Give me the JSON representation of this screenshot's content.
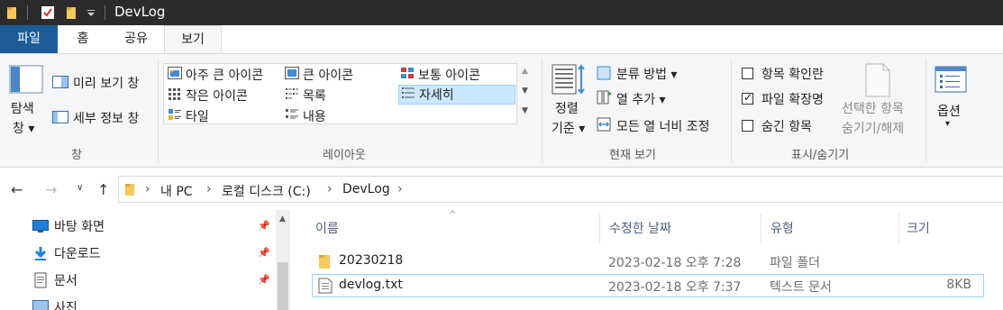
{
  "window": {
    "title": "DevLog"
  },
  "ribbon_tabs": [
    "파일",
    "홈",
    "공유",
    "보기"
  ],
  "ribbon": {
    "pane_group": {
      "navigation_pane_label_1": "탐색",
      "navigation_pane_label_2": "창 ▾",
      "preview_pane": "미리 보기 창",
      "details_pane": "세부 정보 창",
      "group_label": "창"
    },
    "layout_group": {
      "items": [
        "아주 큰 아이콘",
        "큰 아이콘",
        "보통 아이콘",
        "작은 아이콘",
        "목록",
        "자세히",
        "타일",
        "내용"
      ],
      "selected": "자세히",
      "group_label": "레이아웃"
    },
    "current_view_group": {
      "sort_by_1": "정렬",
      "sort_by_2": "기준 ▾",
      "group_by": "분류 방법 ▾",
      "add_columns": "열 추가 ▾",
      "size_all_columns": "모든 열 너비 조정",
      "group_label": "현재 보기"
    },
    "show_hide_group": {
      "item_check_boxes": "항목 확인란",
      "item_check_boxes_checked": false,
      "file_name_extensions": "파일 확장명",
      "file_name_extensions_checked": true,
      "hidden_items": "숨긴 항목",
      "hidden_items_checked": false,
      "hide_selected_1": "선택한 항목",
      "hide_selected_2": "숨기기/해제",
      "group_label": "표시/숨기기"
    },
    "options": {
      "label_1": "옵션",
      "label_2": "▾"
    }
  },
  "address": {
    "crumbs": [
      "내 PC",
      "로컬 디스크 (C:)",
      "DevLog"
    ]
  },
  "nav_pane": {
    "items": [
      "바탕 화면",
      "다운로드",
      "문서",
      "사진"
    ]
  },
  "file_list": {
    "columns": [
      "이름",
      "수정한 날짜",
      "유형",
      "크기"
    ],
    "rows": [
      {
        "name": "20230218",
        "modified": "2023-02-18 오후 7:28",
        "type": "파일 폴더",
        "size": ""
      },
      {
        "name": "devlog.txt",
        "modified": "2023-02-18 오후 7:37",
        "type": "텍스트 문서",
        "size": "8KB"
      }
    ]
  },
  "colors": {
    "file_tab": "#1c5d99",
    "titlebar": "#2b2b2b",
    "selection": "#cce8ff",
    "selection_border": "#99d1ff"
  }
}
